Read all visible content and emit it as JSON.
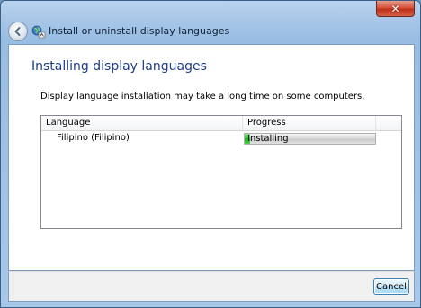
{
  "window": {
    "title": "Install or uninstall display languages",
    "close_icon": "close-icon",
    "back_icon": "back-arrow-icon",
    "app_icon": "language-icon"
  },
  "main": {
    "page_title": "Installing display languages",
    "description": "Display language installation may take a long time on some computers.",
    "list": {
      "columns": [
        "Language",
        "Progress",
        ""
      ],
      "rows": [
        {
          "language": "Filipino (Filipino)",
          "status": "Installing",
          "progress_fraction": 0.04
        }
      ]
    }
  },
  "footer": {
    "cancel_label": "Cancel"
  },
  "colors": {
    "title_text": "#1e3c87",
    "progress_green": "#2fbf2f",
    "close_red": "#c23018"
  }
}
